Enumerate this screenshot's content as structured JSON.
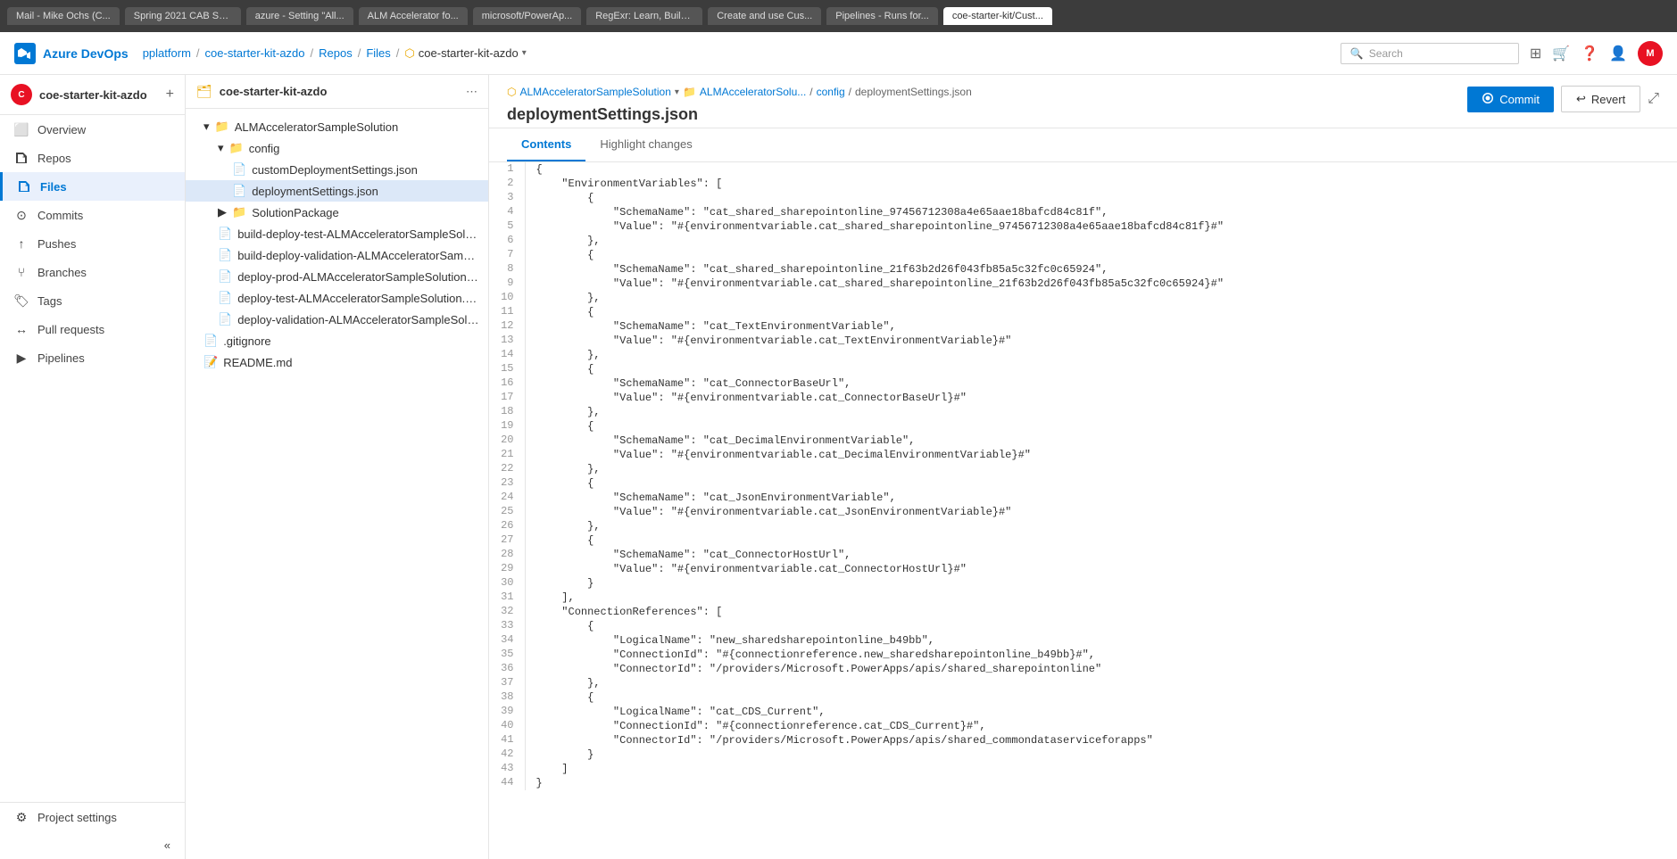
{
  "browser": {
    "tabs": [
      {
        "label": "Mail - Mike Ochs (C...",
        "active": false
      },
      {
        "label": "Spring 2021 CAB Se...",
        "active": false
      },
      {
        "label": "azure - Setting \"All...",
        "active": false
      },
      {
        "label": "ALM Accelerator fo...",
        "active": false
      },
      {
        "label": "microsoft/PowerAp...",
        "active": false
      },
      {
        "label": "RegExr: Learn, Build...",
        "active": false
      },
      {
        "label": "Create and use Cus...",
        "active": false
      },
      {
        "label": "Pipelines - Runs for...",
        "active": false
      },
      {
        "label": "coe-starter-kit/Cust...",
        "active": true
      }
    ]
  },
  "topnav": {
    "logo": "Azure DevOps",
    "breadcrumb": [
      "pplatform",
      "coe-starter-kit-azdo",
      "Repos",
      "Files",
      "coe-starter-kit-azdo"
    ],
    "search_placeholder": "Search"
  },
  "sidebar": {
    "project_name": "coe-starter-kit-azdo",
    "project_initial": "C",
    "items": [
      {
        "label": "Overview",
        "icon": "⬜"
      },
      {
        "label": "Repos",
        "icon": "🗂"
      },
      {
        "label": "Files",
        "icon": "📄",
        "active": true
      },
      {
        "label": "Commits",
        "icon": "⊙"
      },
      {
        "label": "Pushes",
        "icon": "↑"
      },
      {
        "label": "Branches",
        "icon": "⑂"
      },
      {
        "label": "Tags",
        "icon": "🏷"
      },
      {
        "label": "Pull requests",
        "icon": "↔"
      },
      {
        "label": "Pipelines",
        "icon": "▶"
      }
    ],
    "bottom": [
      {
        "label": "Project settings",
        "icon": "⚙"
      }
    ]
  },
  "filetree": {
    "repo_name": "coe-starter-kit-azdo",
    "items": [
      {
        "level": 0,
        "type": "folder",
        "label": "ALMAcceleratorSampleSolution",
        "expanded": true
      },
      {
        "level": 1,
        "type": "folder",
        "label": "config",
        "expanded": true
      },
      {
        "level": 2,
        "type": "file",
        "label": "customDeploymentSettings.json"
      },
      {
        "level": 2,
        "type": "file",
        "label": "deploymentSettings.json",
        "selected": true
      },
      {
        "level": 1,
        "type": "folder",
        "label": "SolutionPackage",
        "expanded": false
      },
      {
        "level": 1,
        "type": "file",
        "label": "build-deploy-test-ALMAcceleratorSampleSolutio..."
      },
      {
        "level": 1,
        "type": "file",
        "label": "build-deploy-validation-ALMAcceleratorSampleS..."
      },
      {
        "level": 1,
        "type": "file",
        "label": "deploy-prod-ALMAcceleratorSampleSolution.yml"
      },
      {
        "level": 1,
        "type": "file",
        "label": "deploy-test-ALMAcceleratorSampleSolution.yml"
      },
      {
        "level": 1,
        "type": "file",
        "label": "deploy-validation-ALMAcceleratorSampleSolutio..."
      },
      {
        "level": 0,
        "type": "file",
        "label": ".gitignore"
      },
      {
        "level": 0,
        "type": "file",
        "label": "README.md"
      }
    ]
  },
  "file_viewer": {
    "breadcrumb": [
      "ALMAcceleratorSampleSolution",
      "ALMAcceleratorSolu...",
      "config",
      "deploymentSettings.json"
    ],
    "filename": "deploymentSettings.json",
    "branch": "ALMAcceleratorSampleSolution",
    "tabs": [
      {
        "label": "Contents",
        "active": true
      },
      {
        "label": "Highlight changes",
        "active": false
      }
    ],
    "commit_btn": "Commit",
    "revert_btn": "Revert",
    "expand_icon": "⤢",
    "code_lines": [
      {
        "n": 1,
        "code": "{"
      },
      {
        "n": 2,
        "code": "    \"EnvironmentVariables\": ["
      },
      {
        "n": 3,
        "code": "        {"
      },
      {
        "n": 4,
        "code": "            \"SchemaName\": \"cat_shared_sharepointonline_97456712308a4e65aae18bafcd84c81f\","
      },
      {
        "n": 5,
        "code": "            \"Value\": \"#{environmentvariable.cat_shared_sharepointonline_97456712308a4e65aae18bafcd84c81f}#\""
      },
      {
        "n": 6,
        "code": "        },"
      },
      {
        "n": 7,
        "code": "        {"
      },
      {
        "n": 8,
        "code": "            \"SchemaName\": \"cat_shared_sharepointonline_21f63b2d26f043fb85a5c32fc0c65924\","
      },
      {
        "n": 9,
        "code": "            \"Value\": \"#{environmentvariable.cat_shared_sharepointonline_21f63b2d26f043fb85a5c32fc0c65924}#\""
      },
      {
        "n": 10,
        "code": "        },"
      },
      {
        "n": 11,
        "code": "        {"
      },
      {
        "n": 12,
        "code": "            \"SchemaName\": \"cat_TextEnvironmentVariable\","
      },
      {
        "n": 13,
        "code": "            \"Value\": \"#{environmentvariable.cat_TextEnvironmentVariable}#\""
      },
      {
        "n": 14,
        "code": "        },"
      },
      {
        "n": 15,
        "code": "        {"
      },
      {
        "n": 16,
        "code": "            \"SchemaName\": \"cat_ConnectorBaseUrl\","
      },
      {
        "n": 17,
        "code": "            \"Value\": \"#{environmentvariable.cat_ConnectorBaseUrl}#\""
      },
      {
        "n": 18,
        "code": "        },"
      },
      {
        "n": 19,
        "code": "        {"
      },
      {
        "n": 20,
        "code": "            \"SchemaName\": \"cat_DecimalEnvironmentVariable\","
      },
      {
        "n": 21,
        "code": "            \"Value\": \"#{environmentvariable.cat_DecimalEnvironmentVariable}#\""
      },
      {
        "n": 22,
        "code": "        },"
      },
      {
        "n": 23,
        "code": "        {"
      },
      {
        "n": 24,
        "code": "            \"SchemaName\": \"cat_JsonEnvironmentVariable\","
      },
      {
        "n": 25,
        "code": "            \"Value\": \"#{environmentvariable.cat_JsonEnvironmentVariable}#\""
      },
      {
        "n": 26,
        "code": "        },"
      },
      {
        "n": 27,
        "code": "        {"
      },
      {
        "n": 28,
        "code": "            \"SchemaName\": \"cat_ConnectorHostUrl\","
      },
      {
        "n": 29,
        "code": "            \"Value\": \"#{environmentvariable.cat_ConnectorHostUrl}#\""
      },
      {
        "n": 30,
        "code": "        }"
      },
      {
        "n": 31,
        "code": "    ],"
      },
      {
        "n": 32,
        "code": "    \"ConnectionReferences\": ["
      },
      {
        "n": 33,
        "code": "        {"
      },
      {
        "n": 34,
        "code": "            \"LogicalName\": \"new_sharedsharepointonline_b49bb\","
      },
      {
        "n": 35,
        "code": "            \"ConnectionId\": \"#{connectionreference.new_sharedsharepointonline_b49bb}#\","
      },
      {
        "n": 36,
        "code": "            \"ConnectorId\": \"/providers/Microsoft.PowerApps/apis/shared_sharepointonline\""
      },
      {
        "n": 37,
        "code": "        },"
      },
      {
        "n": 38,
        "code": "        {"
      },
      {
        "n": 39,
        "code": "            \"LogicalName\": \"cat_CDS_Current\","
      },
      {
        "n": 40,
        "code": "            \"ConnectionId\": \"#{connectionreference.cat_CDS_Current}#\","
      },
      {
        "n": 41,
        "code": "            \"ConnectorId\": \"/providers/Microsoft.PowerApps/apis/shared_commondataserviceforapps\""
      },
      {
        "n": 42,
        "code": "        }"
      },
      {
        "n": 43,
        "code": "    ]"
      },
      {
        "n": 44,
        "code": "}"
      }
    ]
  }
}
